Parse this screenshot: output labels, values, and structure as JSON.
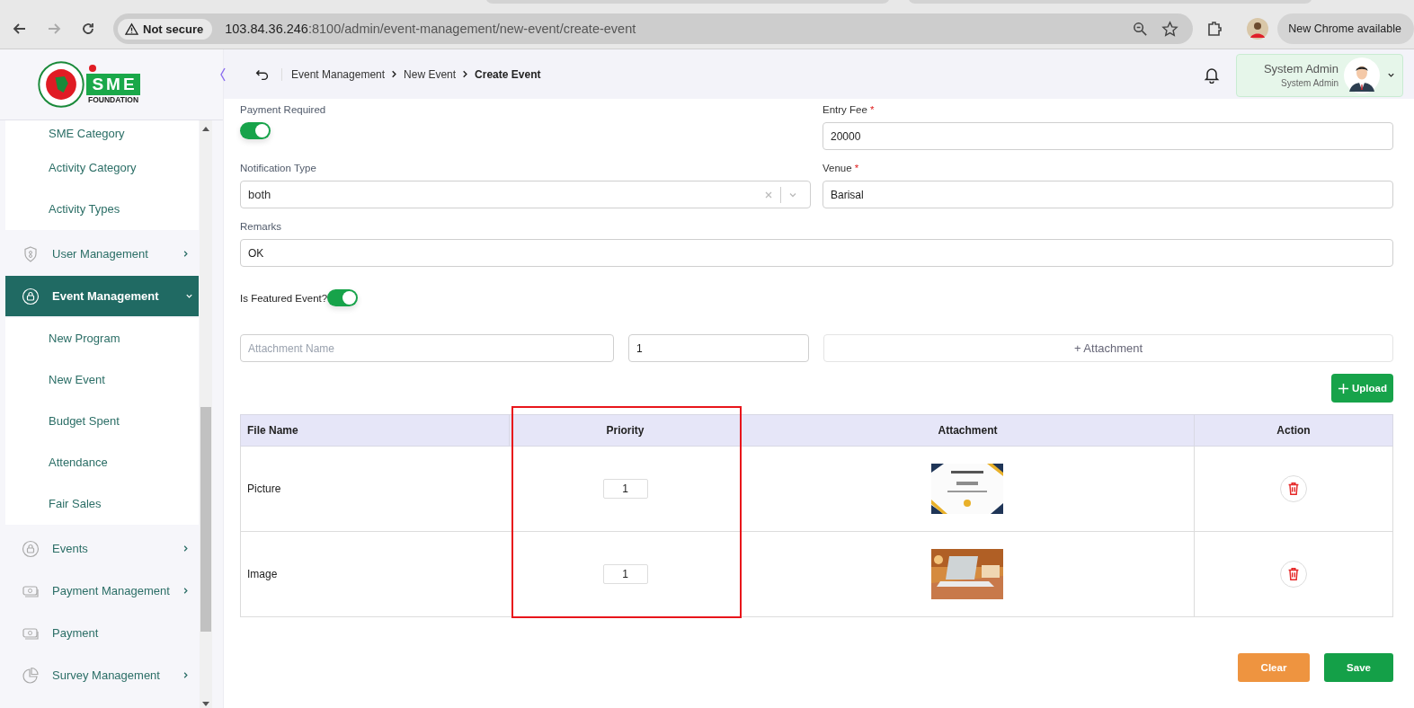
{
  "browser": {
    "security": "Not secure",
    "url_host": "103.84.36.246",
    "url_path": ":8100/admin/event-management/new-event/create-event",
    "update_button": "New Chrome available"
  },
  "logo": {
    "letters": "SME",
    "tagline": "FOUNDATION"
  },
  "header": {
    "breadcrumb": [
      "Event Management",
      "New Event",
      "Create Event"
    ],
    "user": {
      "name": "System Admin",
      "role": "System Admin"
    }
  },
  "sidebar": {
    "items": [
      {
        "kind": "sub",
        "label": "SME Category"
      },
      {
        "kind": "sub",
        "label": "Activity Category"
      },
      {
        "kind": "sub",
        "label": "Activity Types"
      },
      {
        "kind": "group",
        "label": "User Management",
        "selected": false,
        "expanded": false
      },
      {
        "kind": "group",
        "label": "Event Management",
        "selected": true,
        "expanded": true
      },
      {
        "kind": "sub",
        "label": "New Program"
      },
      {
        "kind": "sub",
        "label": "New Event"
      },
      {
        "kind": "sub",
        "label": "Budget Spent"
      },
      {
        "kind": "sub",
        "label": "Attendance"
      },
      {
        "kind": "sub",
        "label": "Fair Sales"
      },
      {
        "kind": "group",
        "label": "Events",
        "selected": false,
        "expanded": false
      },
      {
        "kind": "group",
        "label": "Payment Management",
        "selected": false,
        "expanded": false
      },
      {
        "kind": "link",
        "label": "Payment",
        "selected": false
      },
      {
        "kind": "group",
        "label": "Survey Management",
        "selected": false,
        "expanded": false
      }
    ]
  },
  "form": {
    "payment_required": {
      "label": "Payment Required",
      "on": true
    },
    "entry_fee": {
      "label": "Entry Fee",
      "required_mark": "*",
      "value": "20000"
    },
    "notification_type": {
      "label": "Notification Type",
      "value": "both"
    },
    "venue": {
      "label": "Venue",
      "required_mark": "*",
      "value": "Barisal"
    },
    "remarks": {
      "label": "Remarks",
      "value": "OK"
    },
    "featured": {
      "label": "Is Featured Event?",
      "on": true
    },
    "attachment": {
      "name_placeholder": "Attachment Name",
      "priority": "1",
      "add_button": "+ Attachment"
    },
    "upload_button": "Upload"
  },
  "table": {
    "columns": [
      "File Name",
      "Priority",
      "Attachment",
      "Action"
    ],
    "rows": [
      {
        "file_name": "Picture",
        "priority": "1"
      },
      {
        "file_name": "Image",
        "priority": "1"
      }
    ]
  },
  "buttons": {
    "clear": "Clear",
    "save": "Save"
  }
}
